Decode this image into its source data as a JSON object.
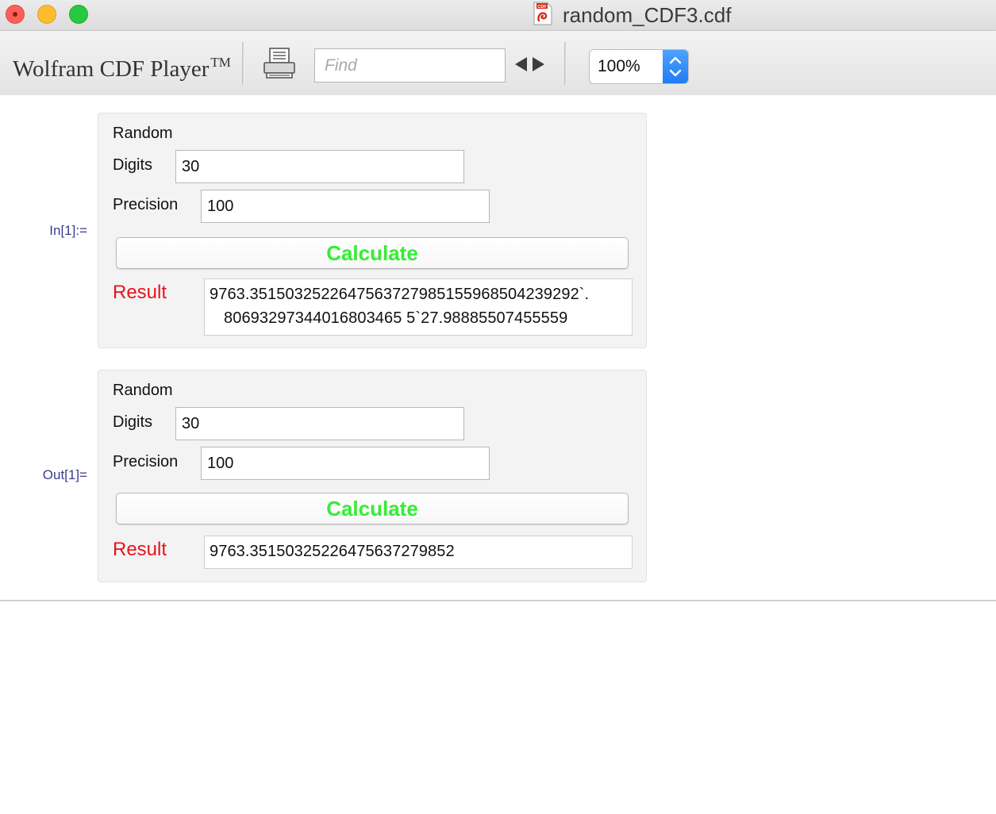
{
  "window": {
    "title": "random_CDF3.cdf",
    "doc_icon_label": "CDF"
  },
  "toolbar": {
    "brand": "Wolfram CDF Player",
    "brand_mark": "TM",
    "find_placeholder": "Find",
    "find_value": "",
    "zoom": "100%"
  },
  "cells": {
    "input_label": "In[1]:=",
    "output_label": "Out[1]="
  },
  "panel_in": {
    "title": "Random",
    "digits_label": "Digits",
    "digits_value": "30",
    "precision_label": "Precision",
    "precision_value": "100",
    "calculate_label": "Calculate",
    "result_label": "Result",
    "result_line1": "9763.3515032522647563727985155968504239292`.",
    "result_line2": "80693297344016803465 5`27.98885507455559"
  },
  "panel_out": {
    "title": "Random",
    "digits_label": "Digits",
    "digits_value": "30",
    "precision_label": "Precision",
    "precision_value": "100",
    "calculate_label": "Calculate",
    "result_label": "Result",
    "result_value": "9763.35150325226475637279852"
  },
  "colors": {
    "calculate_text": "#33ee33",
    "result_label": "#e5141b",
    "cell_label": "#3c3c8c",
    "zoom_stepper": "#2b86f8"
  }
}
